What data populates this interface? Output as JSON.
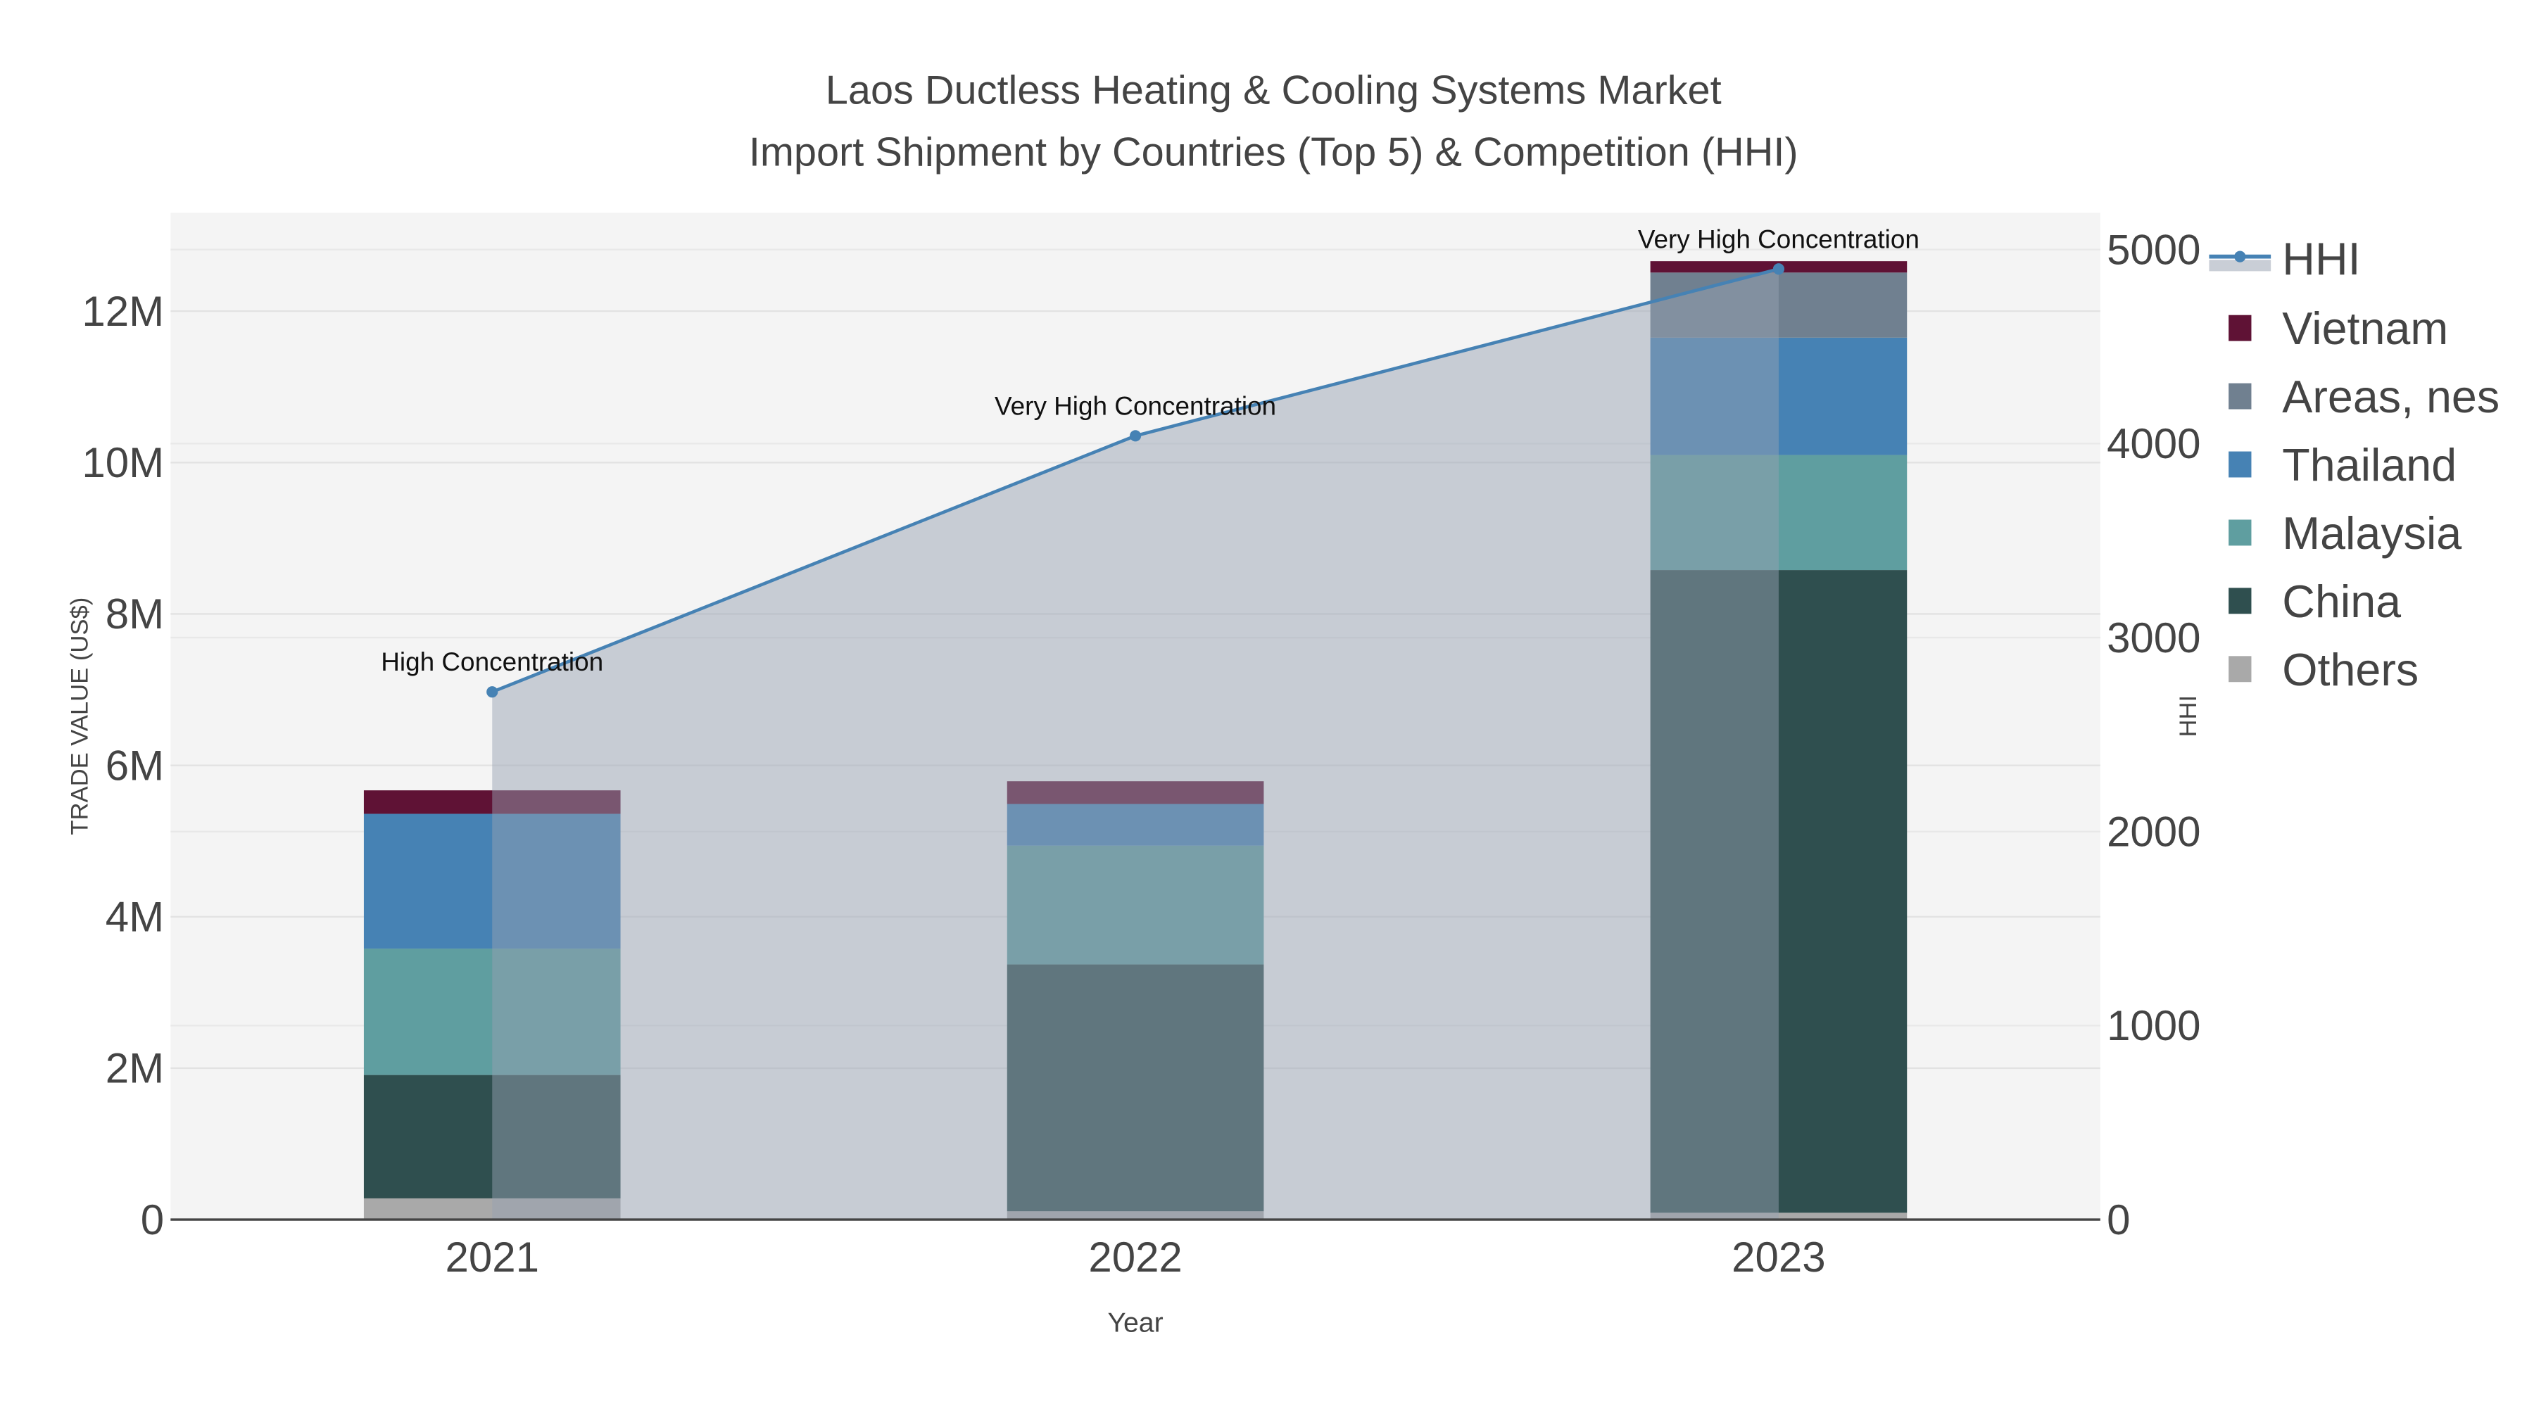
{
  "chart_data": {
    "type": "bar",
    "stacked": true,
    "title_line1": "Laos Ductless Heating & Cooling Systems Market",
    "title_line2": "Import Shipment by Countries (Top 5) & Competition (HHI)",
    "xlabel": "Year",
    "ylabel": "TRADE VALUE (US$)",
    "y2label": "HHI",
    "categories": [
      "2021",
      "2022",
      "2023"
    ],
    "ylim": [
      0,
      13300000
    ],
    "y2lim": [
      0,
      5190
    ],
    "yticks": [
      {
        "v": 0,
        "label": "0"
      },
      {
        "v": 2000000,
        "label": "2M"
      },
      {
        "v": 4000000,
        "label": "4M"
      },
      {
        "v": 6000000,
        "label": "6M"
      },
      {
        "v": 8000000,
        "label": "8M"
      },
      {
        "v": 10000000,
        "label": "10M"
      },
      {
        "v": 12000000,
        "label": "12M"
      }
    ],
    "y2ticks": [
      {
        "v": 0,
        "label": "0"
      },
      {
        "v": 1000,
        "label": "1000"
      },
      {
        "v": 2000,
        "label": "2000"
      },
      {
        "v": 3000,
        "label": "3000"
      },
      {
        "v": 4000,
        "label": "4000"
      },
      {
        "v": 5000,
        "label": "5000"
      }
    ],
    "series": [
      {
        "name": "Others",
        "color": "#a9a9a9",
        "values": [
          280000,
          110000,
          90000
        ]
      },
      {
        "name": "China",
        "color": "#2f4f4f",
        "values": [
          1630000,
          3260000,
          8490000
        ]
      },
      {
        "name": "Malaysia",
        "color": "#5f9ea0",
        "values": [
          1670000,
          1570000,
          1520000
        ]
      },
      {
        "name": "Thailand",
        "color": "#4682b4",
        "values": [
          1780000,
          550000,
          1550000
        ]
      },
      {
        "name": "Areas, nes",
        "color": "#708090",
        "values": [
          0,
          0,
          860000
        ]
      },
      {
        "name": "Vietnam",
        "color": "#5f1235",
        "values": [
          310000,
          300000,
          150000
        ]
      }
    ],
    "hhi": {
      "name": "HHI",
      "color": "#4682b4",
      "values": [
        2720,
        4040,
        4900
      ],
      "annotations": [
        "High Concentration",
        "Very High Concentration",
        "Very High Concentration"
      ]
    },
    "legend": [
      "HHI",
      "Vietnam",
      "Areas, nes",
      "Thailand",
      "Malaysia",
      "China",
      "Others"
    ],
    "legend_position": "right",
    "grid": true
  }
}
